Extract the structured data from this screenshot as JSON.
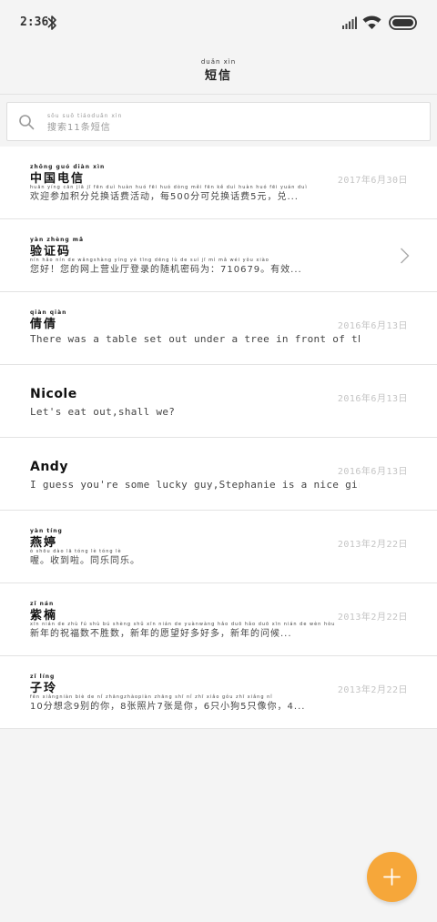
{
  "status_bar": {
    "time": "2:36"
  },
  "header": {
    "title_pinyin": "duǎn xìn",
    "title": "短信"
  },
  "search": {
    "pinyin": "sōu suǒ   tiáoduǎn xìn",
    "placeholder": "搜索11条短信"
  },
  "messages": [
    {
      "sender_pinyin": "zhōng guó diàn xìn",
      "sender": "中国电信",
      "date": "2017年6月30日",
      "preview_pinyin": "huān yíng cān jiā  jī   fēn  duì huàn huó  fēi huó dòng        měi            fēn  kě   duì huàn huó  fēi   yuán        duì",
      "preview": "欢迎参加积分兑换话费活动，每500分可兑换话费5元，兑..."
    },
    {
      "sender_pinyin": "yàn zhèng mǎ",
      "sender": "验证码",
      "date": "",
      "preview_pinyin": "nín hǎo      nín   de  wǎngshàng yíng  yè  tīng dēng  lù   de   suí   jī    mì   mǎ  wéi                                yǒu xiào",
      "preview": "您好！您的网上营业厅登录的随机密码为：710679。有效..."
    },
    {
      "sender_pinyin": "qiàn qiàn",
      "sender": "倩倩",
      "date": "2016年6月13日",
      "preview_pinyin": "",
      "preview": "There was a table set out under a tree in front of the hous"
    },
    {
      "sender_pinyin": "",
      "sender": "Nicole",
      "date": "2016年6月13日",
      "preview_pinyin": "",
      "preview": "Let's eat out,shall we?"
    },
    {
      "sender_pinyin": "",
      "sender": "Andy",
      "date": "2016年6月13日",
      "preview_pinyin": "",
      "preview": "I guess you're some lucky guy,Stephanie is a nice girl."
    },
    {
      "sender_pinyin": "yàn tíng",
      "sender": "燕婷",
      "date": "2013年2月22日",
      "preview_pinyin": "  ò        shōu dào  lā        tóng  lè   tóng  lè",
      "preview": "喔。收到啦。同乐同乐。"
    },
    {
      "sender_pinyin": "zǐ  nán",
      "sender": "紫楠",
      "date": "2013年2月22日",
      "preview_pinyin": "xīn  nián  de  zhù  fú   shù  bú shèng shǔ      xīn  nián  de  yuànwàng hǎo duō hǎo duō      xīn  nián  de  wèn hòu",
      "preview": "新年的祝福数不胜数，新年的愿望好多好多，新年的问候..."
    },
    {
      "sender_pinyin": "zǐ  líng",
      "sender": "子玲",
      "date": "2013年2月22日",
      "preview_pinyin": "     fēn xiǎngniàn       biè  de  nǐ        zhāngzhàopiàn    zhāng shī  nǐ         zhī xiǎo gǒu    zhī xiǎng  nǐ",
      "preview": "10分想念9别的你，8张照片7张是你，6只小狗5只像你，4..."
    }
  ]
}
